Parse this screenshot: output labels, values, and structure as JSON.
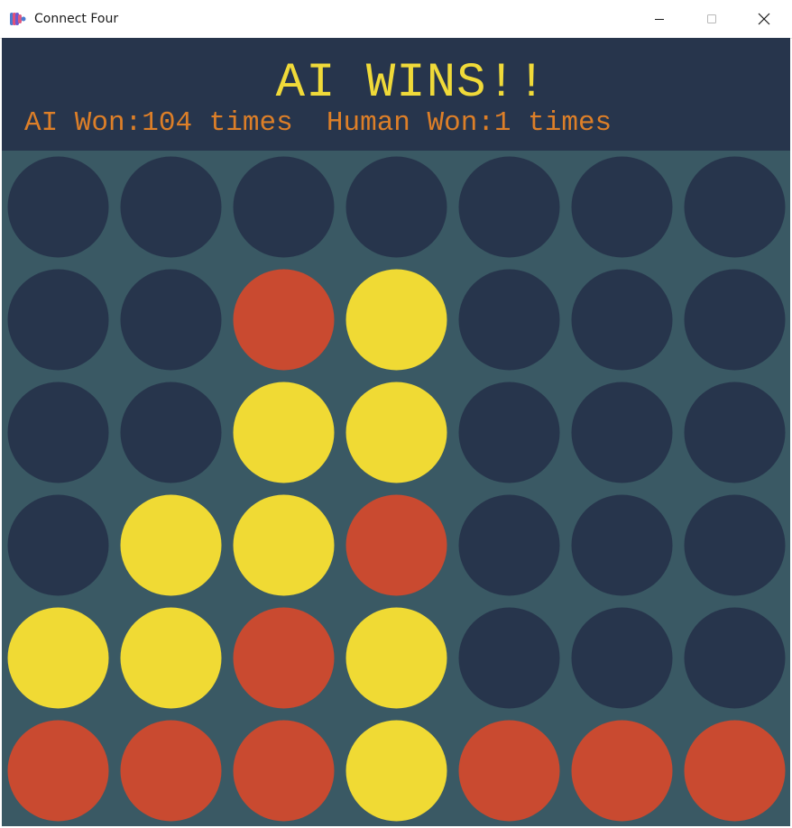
{
  "window": {
    "title": "Connect Four",
    "controls": {
      "minimize_icon": "minimize-icon",
      "maximize_icon": "maximize-icon",
      "close_icon": "close-icon"
    }
  },
  "game": {
    "result": "AI WINS!!",
    "ai_label": "AI Won:",
    "ai_wins": "104",
    "human_label": "Human Won:",
    "human_wins": "1",
    "times_word": "times"
  },
  "colors": {
    "header_bg": "#27354c",
    "board_bg": "#3a5964",
    "empty": "#27354c",
    "red": "#c94a30",
    "yellow": "#f0da34",
    "title_text": "#f0da39",
    "score_text": "#dd7f28"
  },
  "board": {
    "rows": 6,
    "cols": 7,
    "cells": [
      [
        "empty",
        "empty",
        "empty",
        "empty",
        "empty",
        "empty",
        "empty"
      ],
      [
        "empty",
        "empty",
        "red",
        "yellow",
        "empty",
        "empty",
        "empty"
      ],
      [
        "empty",
        "empty",
        "yellow",
        "yellow",
        "empty",
        "empty",
        "empty"
      ],
      [
        "empty",
        "yellow",
        "yellow",
        "red",
        "empty",
        "empty",
        "empty"
      ],
      [
        "yellow",
        "yellow",
        "red",
        "yellow",
        "empty",
        "empty",
        "empty"
      ],
      [
        "red",
        "red",
        "red",
        "yellow",
        "red",
        "red",
        "red"
      ]
    ]
  }
}
